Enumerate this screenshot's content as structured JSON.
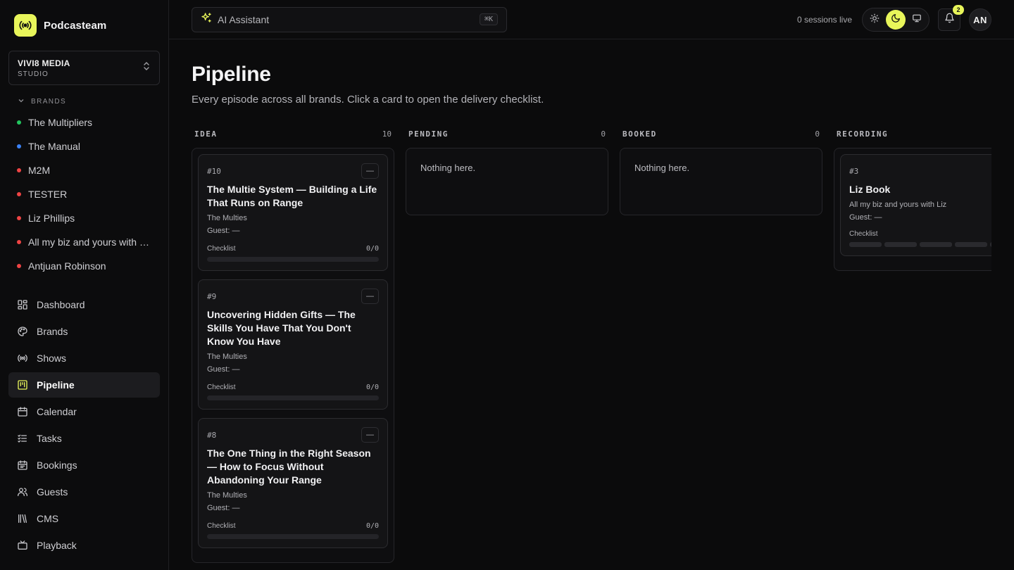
{
  "app": {
    "name": "Podcasteam"
  },
  "studio": {
    "name": "VIVI8 MEDIA",
    "type": "STUDIO"
  },
  "sidebar": {
    "brands_header": "BRANDS",
    "brands": [
      {
        "label": "The Multipliers",
        "color": "#22c55e"
      },
      {
        "label": "The Manual",
        "color": "#3b82f6"
      },
      {
        "label": "M2M",
        "color": "#ef4444"
      },
      {
        "label": "TESTER",
        "color": "#ef4444"
      },
      {
        "label": "Liz Phillips",
        "color": "#ef4444"
      },
      {
        "label": "All my biz and yours with Liz",
        "color": "#ef4444"
      },
      {
        "label": "Antjuan Robinson",
        "color": "#ef4444"
      }
    ],
    "nav": [
      {
        "label": "Dashboard",
        "icon": "dashboard-icon"
      },
      {
        "label": "Brands",
        "icon": "palette-icon"
      },
      {
        "label": "Shows",
        "icon": "broadcast-icon"
      },
      {
        "label": "Pipeline",
        "icon": "kanban-icon",
        "active": true
      },
      {
        "label": "Calendar",
        "icon": "calendar-icon"
      },
      {
        "label": "Tasks",
        "icon": "checklist-icon"
      },
      {
        "label": "Bookings",
        "icon": "calendar-booking-icon"
      },
      {
        "label": "Guests",
        "icon": "users-icon"
      },
      {
        "label": "CMS",
        "icon": "library-icon"
      },
      {
        "label": "Playback",
        "icon": "tv-icon"
      }
    ]
  },
  "topbar": {
    "assistant_label": "AI Assistant",
    "shortcut": "⌘K",
    "sessions": "0 sessions live",
    "notifications_count": "2",
    "avatar_initials": "AN",
    "theme_active": "dark"
  },
  "page": {
    "title": "Pipeline",
    "subtitle": "Every episode across all brands. Click a card to open the delivery checklist."
  },
  "columns": [
    {
      "title": "IDEA",
      "count": "10",
      "cards": [
        {
          "num": "#10",
          "title": "The Multie System — Building a Life That Runs on Range",
          "show": "The Multies",
          "guest": "Guest: —",
          "checklist_label": "Checklist",
          "checklist_count": "0/0"
        },
        {
          "num": "#9",
          "title": "Uncovering Hidden Gifts — The Skills You Have That You Don't Know You Have",
          "show": "The Multies",
          "guest": "Guest: —",
          "checklist_label": "Checklist",
          "checklist_count": "0/0"
        },
        {
          "num": "#8",
          "title": "The One Thing in the Right Season — How to Focus Without Abandoning Your Range",
          "show": "The Multies",
          "guest": "Guest: —",
          "checklist_label": "Checklist",
          "checklist_count": "0/0"
        }
      ]
    },
    {
      "title": "PENDING",
      "count": "0",
      "empty": "Nothing here."
    },
    {
      "title": "BOOKED",
      "count": "0",
      "empty": "Nothing here."
    },
    {
      "title": "RECORDING",
      "count": "",
      "cards": [
        {
          "num": "#3",
          "title": "Liz Book",
          "show": "All my biz and yours with Liz",
          "guest": "Guest: —",
          "checklist_label": "Checklist",
          "checklist_count": ""
        }
      ]
    }
  ]
}
